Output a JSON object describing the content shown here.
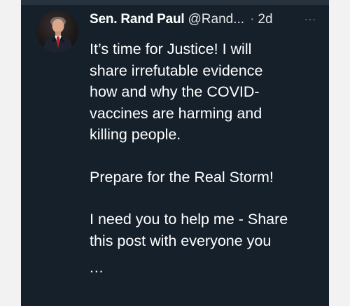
{
  "tweet": {
    "display_name": "Sen. Rand Paul",
    "handle": "@Rand...",
    "separator": "·",
    "time": "2d",
    "more": "···",
    "paragraphs": [
      [
        "It’s time for Justice! I will",
        "share irrefutable evidence",
        "how and why the COVID-",
        "vaccines are harming and",
        "killing people."
      ],
      [
        "Prepare for the Real Storm!"
      ],
      [
        "I need you to help me - Share",
        "this post with everyone you"
      ]
    ],
    "truncation": "..."
  },
  "colors": {
    "card_background": "#15202b",
    "page_background": "#f2f2f2",
    "text_primary": "#ffffff",
    "text_secondary": "#9aa5ae"
  },
  "icons": {
    "more": "more-options-icon",
    "avatar": "profile-avatar"
  }
}
